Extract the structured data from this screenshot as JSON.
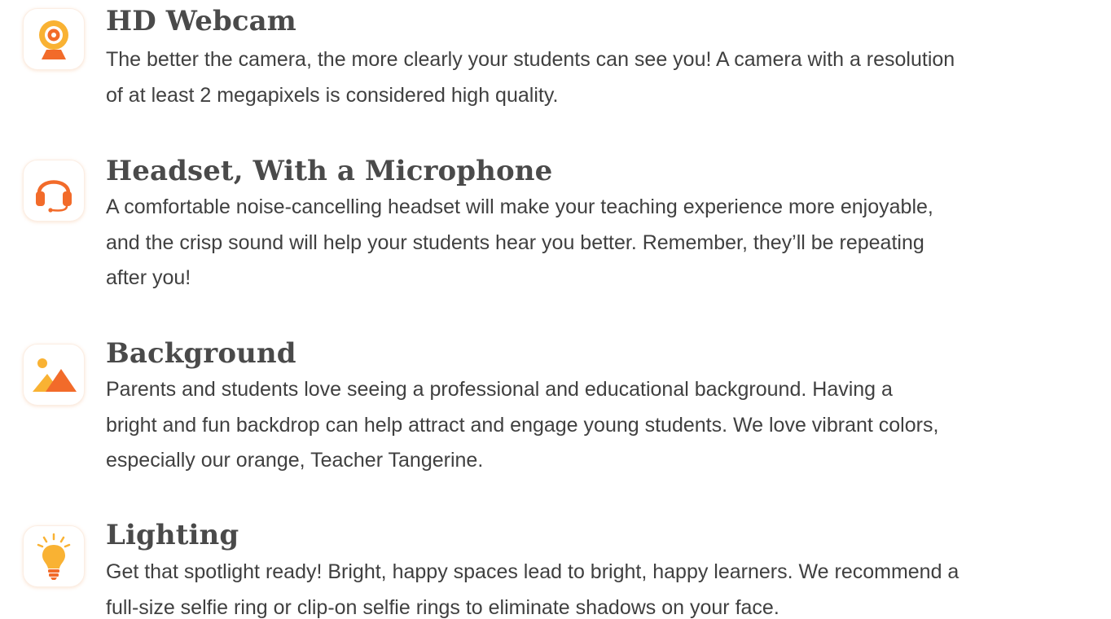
{
  "items": [
    {
      "icon": "webcam-icon",
      "title": "HD Webcam",
      "description": "The better the camera, the more clearly your students can see you! A camera with a resolution\nof at least 2 megapixels is considered high quality."
    },
    {
      "icon": "headset-icon",
      "title": "Headset, With a Microphone",
      "description": "A comfortable noise-cancelling headset will make your teaching experience more enjoyable,\nand the crisp sound will help your students hear you better. Remember, they’ll be repeating\nafter you!"
    },
    {
      "icon": "image-icon",
      "title": "Background",
      "description": "Parents and students love seeing a professional and educational background. Having a\nbright and fun backdrop can help attract and engage young students. We love vibrant colors,\nespecially our orange, Teacher Tangerine."
    },
    {
      "icon": "lightbulb-icon",
      "title": "Lighting",
      "description": "Get that spotlight ready! Bright, happy spaces lead to bright, happy learners. We recommend a\nfull-size selfie ring or clip-on selfie rings to eliminate shadows on your face."
    }
  ],
  "colors": {
    "accent_orange": "#f26b2a",
    "accent_yellow": "#f9b233",
    "text": "#404040",
    "title": "#4a4a4a"
  }
}
